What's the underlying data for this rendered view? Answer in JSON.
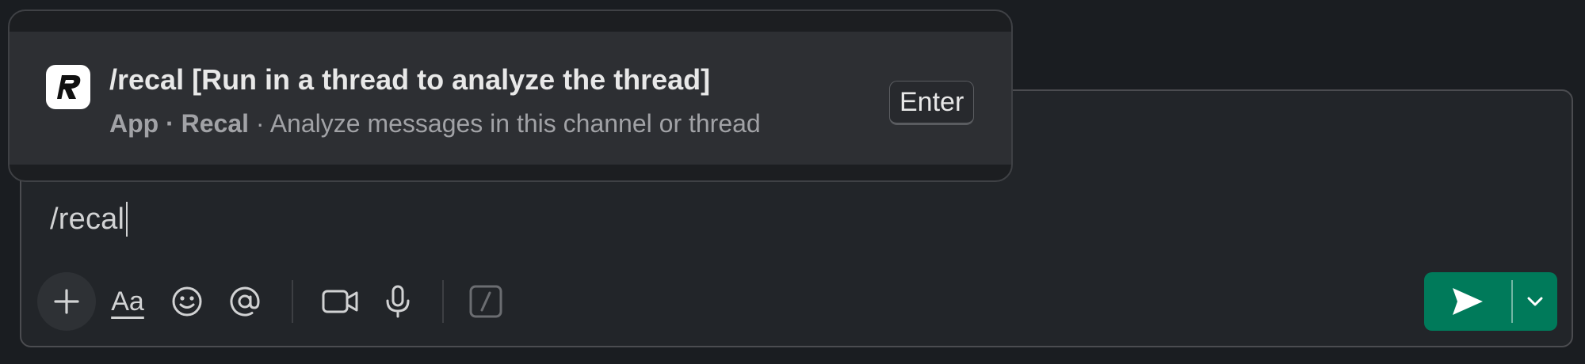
{
  "popup": {
    "command_title": "/recal [Run in a thread to analyze the thread]",
    "subtitle_app": "App · Recal",
    "subtitle_desc": "· Analyze messages in this channel or thread",
    "shortcut": "Enter",
    "app_icon": "recal-logo-icon"
  },
  "composer": {
    "text": "/recal",
    "toolbar": {
      "plus": "plus-icon",
      "format": "Aa",
      "emoji": "emoji-icon",
      "mention": "mention-icon",
      "video": "video-camera-icon",
      "audio": "microphone-icon",
      "shortcuts": "slash-icon"
    },
    "send": "send-icon",
    "send_options": "chevron-down-icon"
  },
  "colors": {
    "background": "#1a1d21",
    "composer": "#222529",
    "popup_row": "#2d2f33",
    "send_green": "#007a5a"
  }
}
